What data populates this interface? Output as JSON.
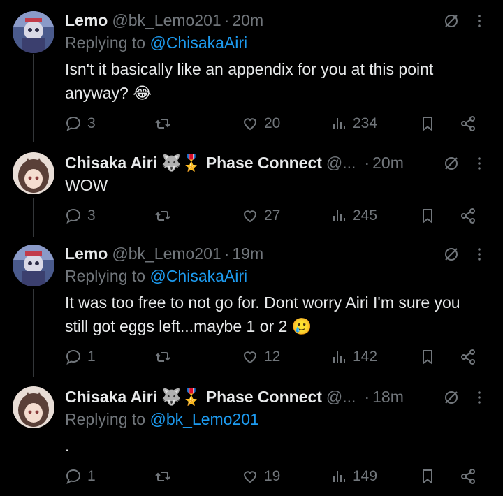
{
  "tweets": [
    {
      "name": "Lemo",
      "handle": "@bk_Lemo201",
      "time": "20m",
      "badges": "",
      "replying_label": "Replying to",
      "replying_to": "@ChisakaAiri",
      "text": "Isn't it basically like an appendix for you at this point anyway? 😂",
      "replies": "3",
      "retweets": "",
      "likes": "20",
      "views": "234"
    },
    {
      "name": "Chisaka Airi",
      "badges": "🐺🎖️ Phase Connect",
      "handle": "@...",
      "time": "20m",
      "replying_label": "",
      "replying_to": "",
      "text": "WOW",
      "replies": "3",
      "retweets": "",
      "likes": "27",
      "views": "245"
    },
    {
      "name": "Lemo",
      "handle": "@bk_Lemo201",
      "time": "19m",
      "badges": "",
      "replying_label": "Replying to",
      "replying_to": "@ChisakaAiri",
      "text": "It was too free to not go for. Dont worry Airi I'm sure you still got eggs left...maybe 1 or 2 🥲",
      "replies": "1",
      "retweets": "",
      "likes": "12",
      "views": "142"
    },
    {
      "name": "Chisaka Airi",
      "badges": "🐺🎖️ Phase Connect",
      "handle": "@...",
      "time": "18m",
      "replying_label": "Replying to",
      "replying_to": "@bk_Lemo201",
      "text": ".",
      "replies": "1",
      "retweets": "",
      "likes": "19",
      "views": "149"
    }
  ],
  "colors": {
    "background": "#000000",
    "text": "#e7e9ea",
    "secondary": "#71767b",
    "link": "#1d9bf0"
  },
  "icons": [
    "reply-icon",
    "retweet-icon",
    "like-icon",
    "views-icon",
    "bookmark-icon",
    "share-icon",
    "grok-icon",
    "more-icon"
  ]
}
